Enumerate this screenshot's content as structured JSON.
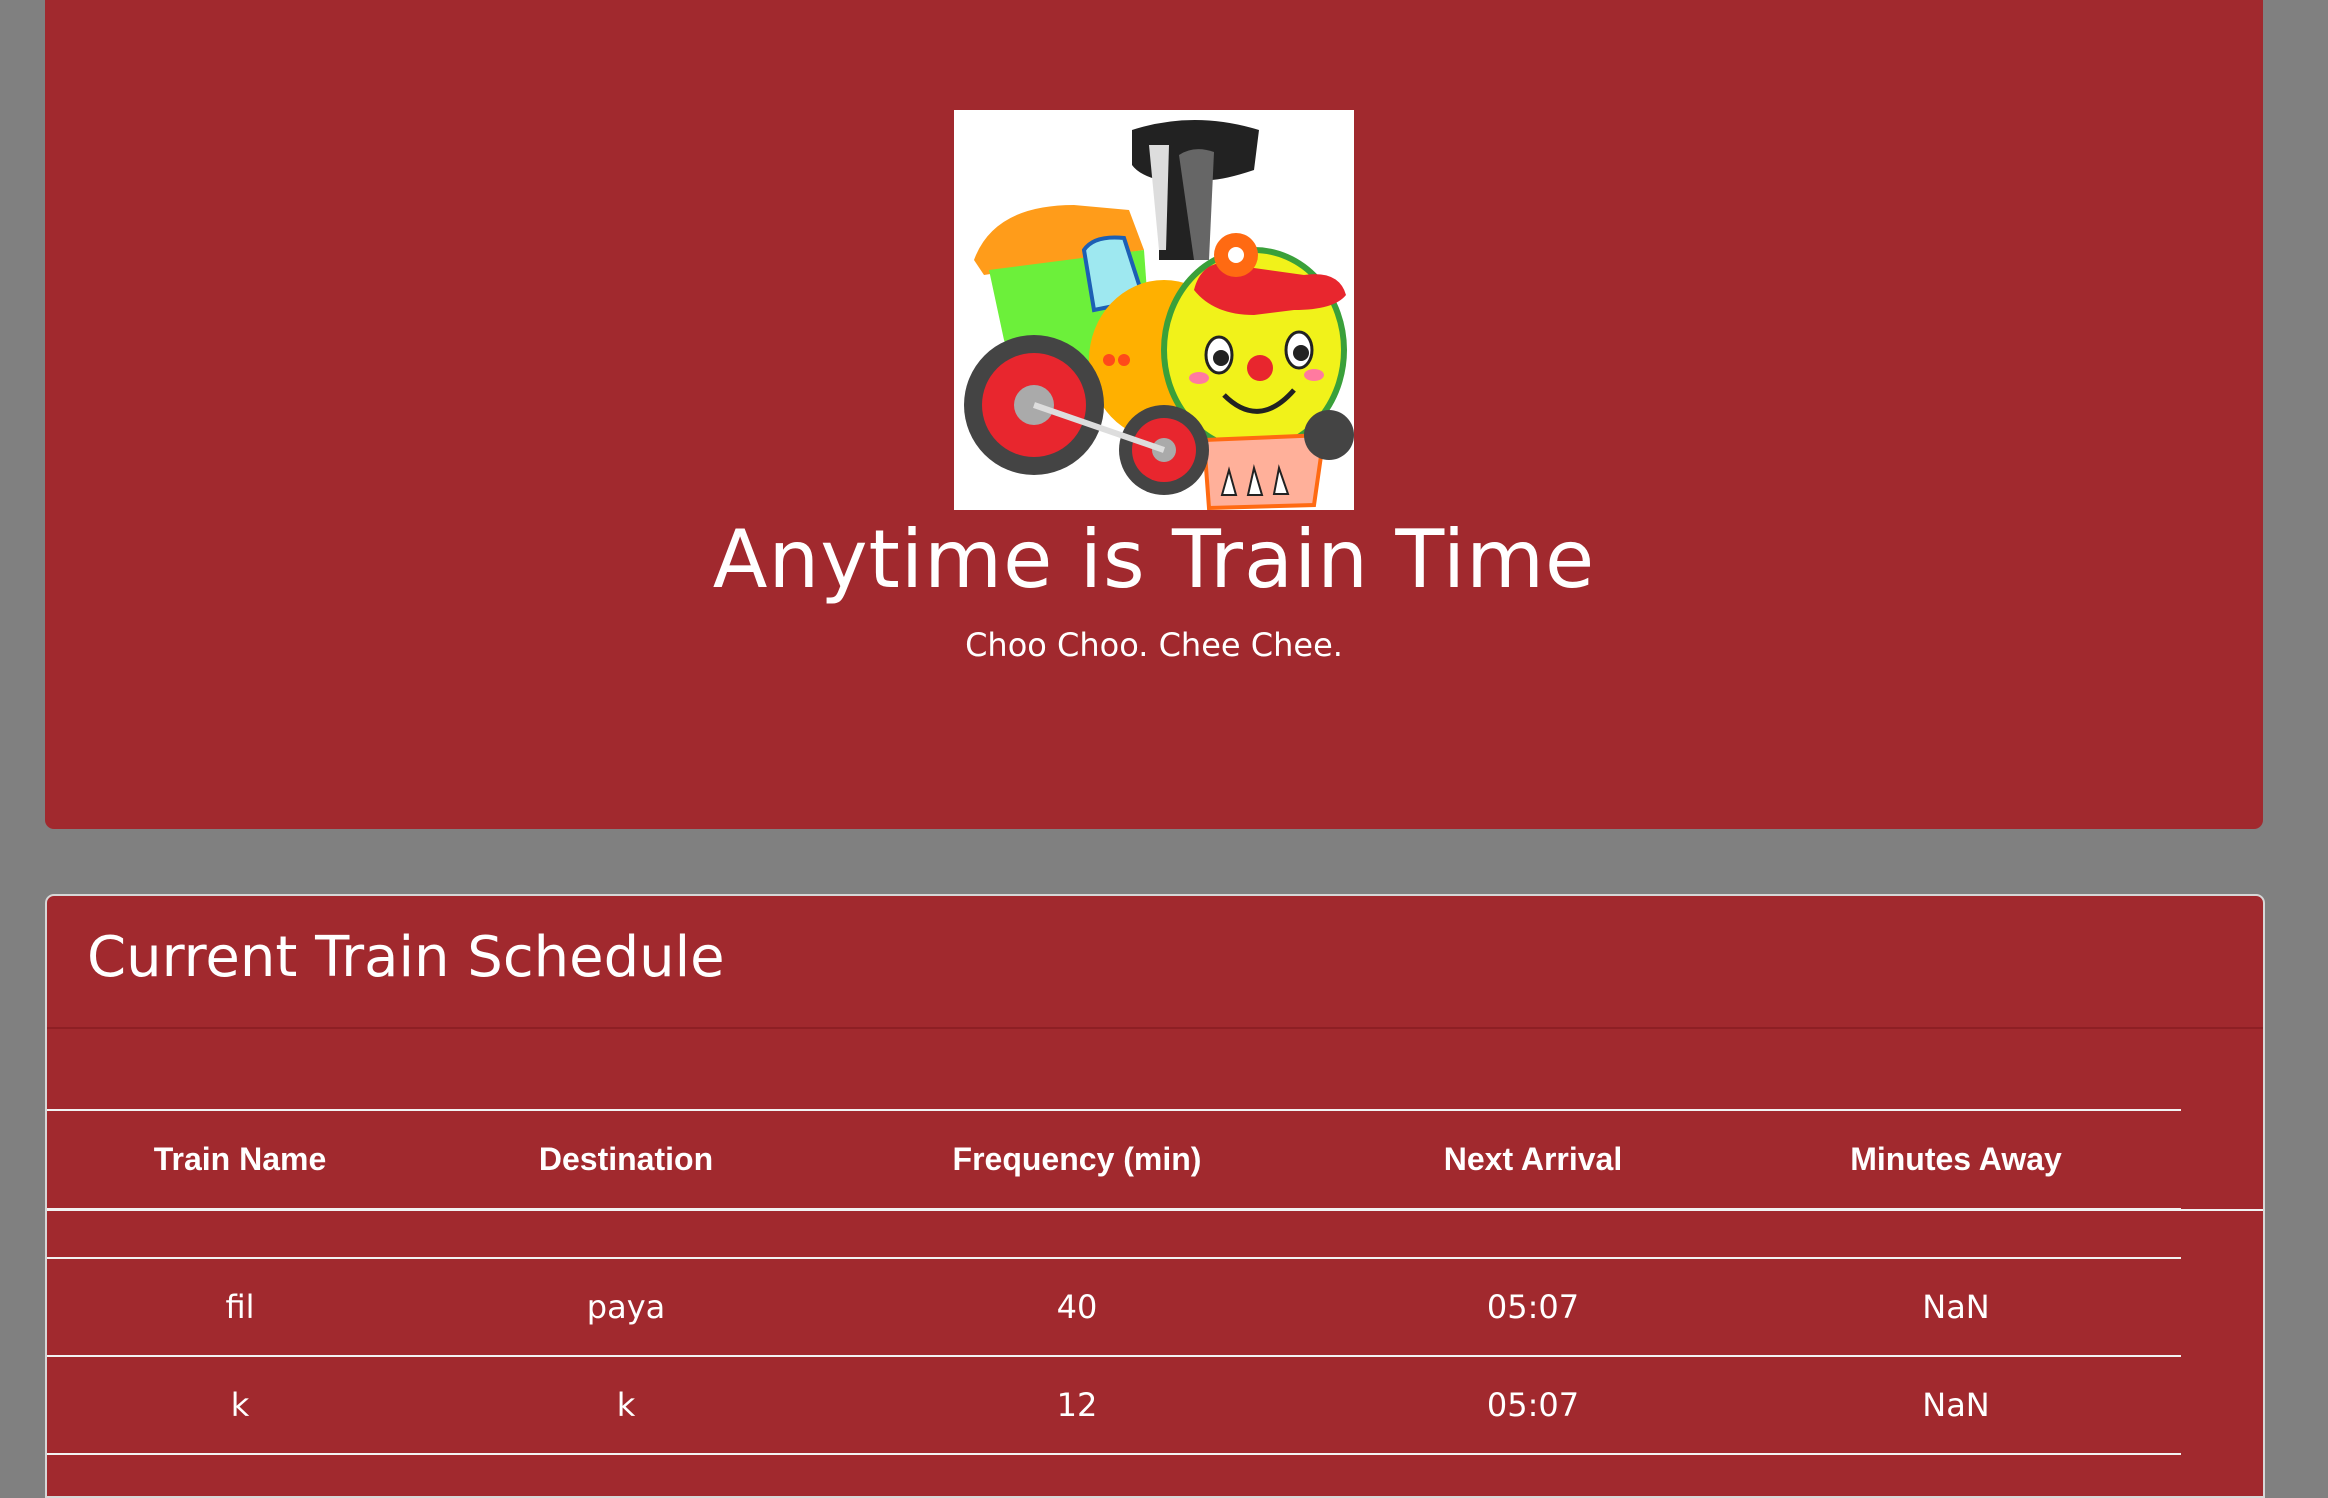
{
  "jumbotron": {
    "logo_icon": "cartoon-train-icon",
    "title": "Anytime is Train Time",
    "subtitle": "Choo Choo. Chee Chee."
  },
  "schedule": {
    "title": "Current Train Schedule",
    "columns": [
      "Train Name",
      "Destination",
      "Frequency (min)",
      "Next Arrival",
      "Minutes Away"
    ],
    "rows": [
      {
        "name": "fil",
        "destination": "paya",
        "frequency": "40",
        "next_arrival": "05:07",
        "minutes_away": "NaN"
      },
      {
        "name": "k",
        "destination": "k",
        "frequency": "12",
        "next_arrival": "05:07",
        "minutes_away": "NaN"
      }
    ]
  },
  "colors": {
    "page_background": "#808080",
    "panel_red": "#a1292e",
    "text": "#ffffff"
  }
}
